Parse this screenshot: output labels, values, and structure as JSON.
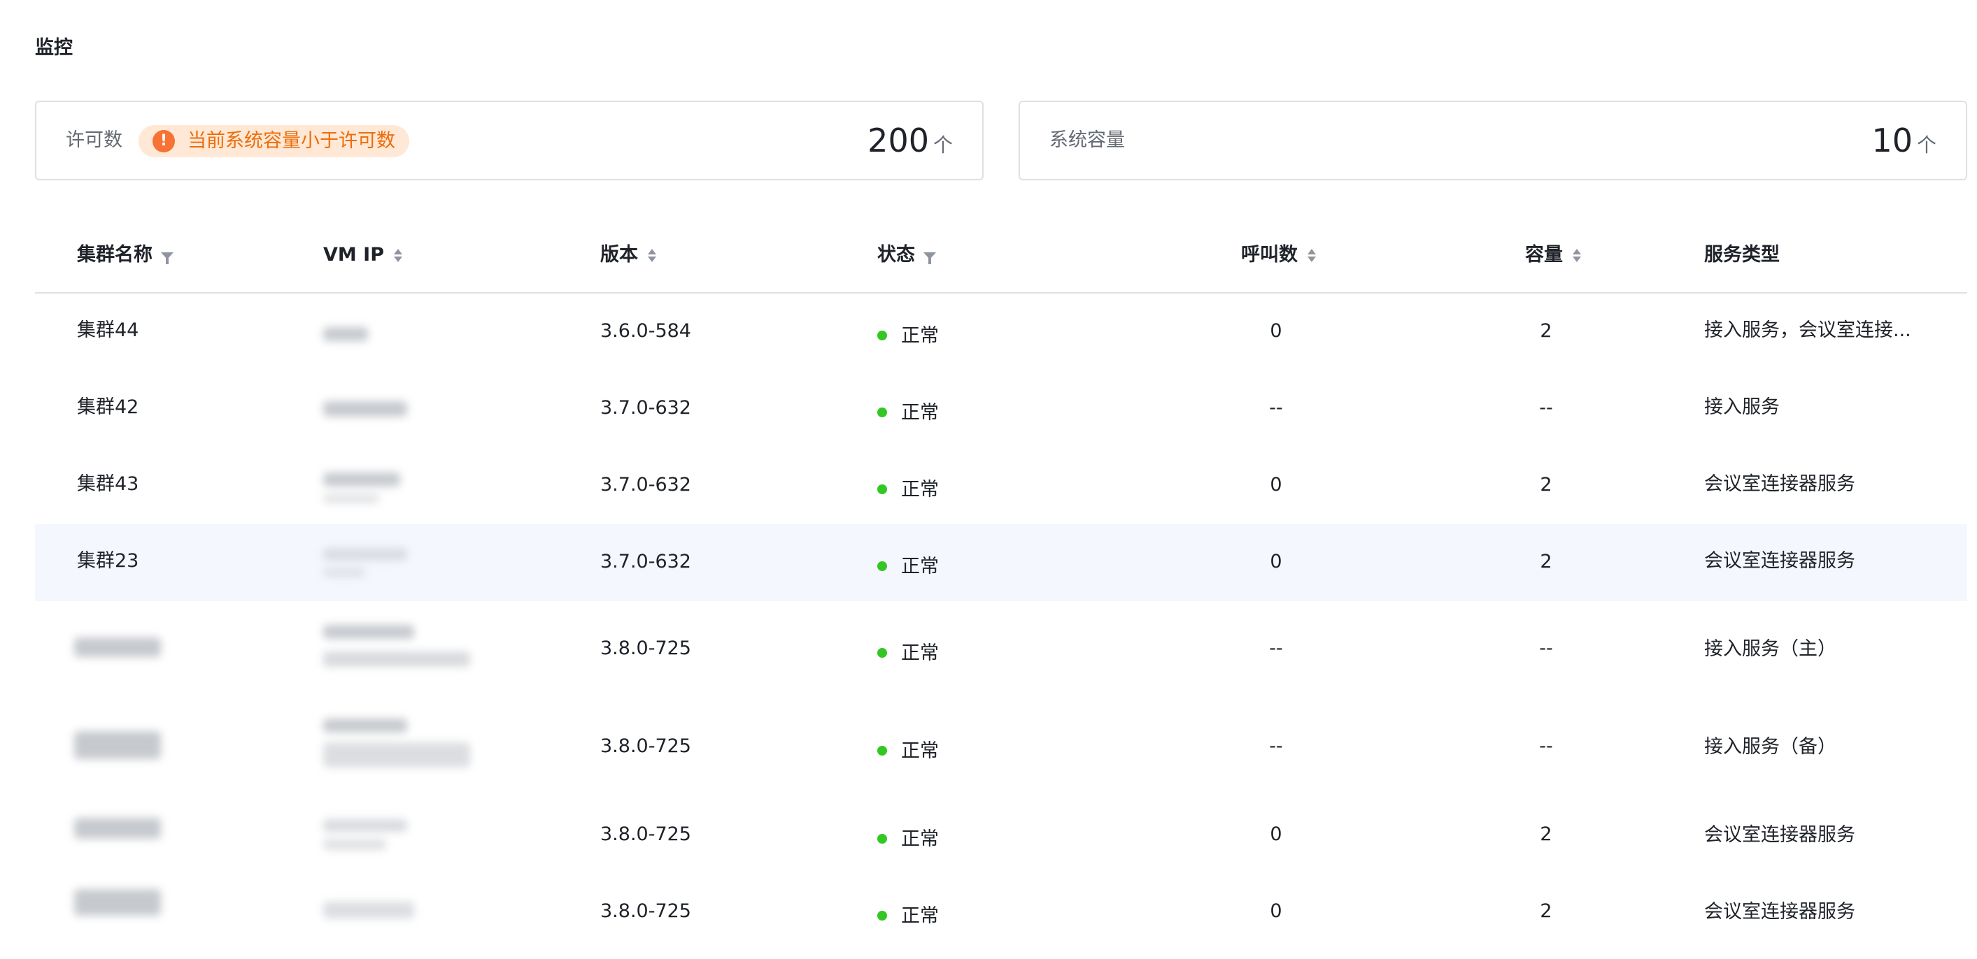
{
  "page_title": "监控",
  "license_card": {
    "label": "许可数",
    "warning": "当前系统容量小于许可数",
    "warning_icon": "exclamation-icon",
    "value": "200",
    "unit": "个"
  },
  "capacity_card": {
    "label": "系统容量",
    "value": "10",
    "unit": "个"
  },
  "table": {
    "columns": [
      {
        "label": "集群名称",
        "control": "filter"
      },
      {
        "label": "VM IP",
        "control": "sort"
      },
      {
        "label": "版本",
        "control": "sort"
      },
      {
        "label": "状态",
        "control": "filter"
      },
      {
        "label": "呼叫数",
        "control": "sort"
      },
      {
        "label": "容量",
        "control": "sort"
      },
      {
        "label": "服务类型",
        "control": "none"
      }
    ],
    "rows": [
      {
        "name": "集群44",
        "version": "3.6.0-584",
        "status": "正常",
        "calls": "0",
        "capacity": "2",
        "service": "接入服务，会议室连接..."
      },
      {
        "name": "集群42",
        "version": "3.7.0-632",
        "status": "正常",
        "calls": "--",
        "capacity": "--",
        "service": "接入服务"
      },
      {
        "name": "集群43",
        "version": "3.7.0-632",
        "status": "正常",
        "calls": "0",
        "capacity": "2",
        "service": "会议室连接器服务"
      },
      {
        "name": "集群23",
        "version": "3.7.0-632",
        "status": "正常",
        "calls": "0",
        "capacity": "2",
        "service": "会议室连接器服务"
      },
      {
        "name": "",
        "version": "3.8.0-725",
        "status": "正常",
        "calls": "--",
        "capacity": "--",
        "service": "接入服务（主）"
      },
      {
        "name": "",
        "version": "3.8.0-725",
        "status": "正常",
        "calls": "--",
        "capacity": "--",
        "service": "接入服务（备）"
      },
      {
        "name": "",
        "version": "3.8.0-725",
        "status": "正常",
        "calls": "0",
        "capacity": "2",
        "service": "会议室连接器服务"
      },
      {
        "name": "",
        "version": "3.8.0-725",
        "status": "正常",
        "calls": "0",
        "capacity": "2",
        "service": "会议室连接器服务"
      }
    ]
  },
  "colors": {
    "status_ok": "#34c724",
    "warning_text": "#ed6d0c",
    "warning_bg": "#ffe8d5",
    "row_highlight": "#f4f7fd"
  }
}
